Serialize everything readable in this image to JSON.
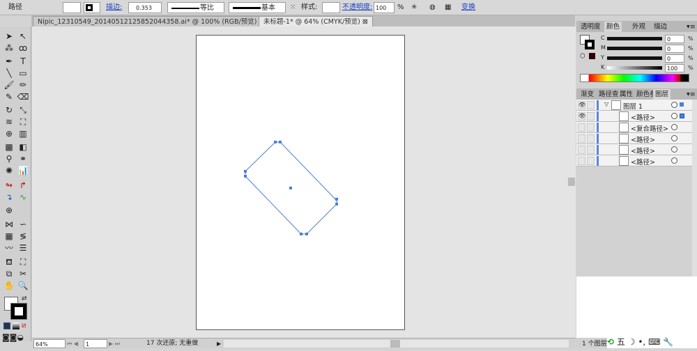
{
  "control_bar": {
    "selection_label": "路径",
    "stroke_label": "描边:",
    "stroke_weight": "0.353",
    "profile_label": "等比",
    "brush_label": "基本",
    "style_label": "样式:",
    "opacity_label": "不透明度:",
    "opacity_value": "100",
    "opacity_unit": "%",
    "transform_label": "变换"
  },
  "doc_tabs": [
    {
      "label": "Nipic_12310549_20140512125852044358.ai* @ 100% (RGB/预览)",
      "active": false
    },
    {
      "label": "未标题-1* @ 64% (CMYK/预览)",
      "active": true
    }
  ],
  "color_panel": {
    "tabs": [
      "透明度",
      "颜色",
      "外观",
      "描边"
    ],
    "active_tab": "颜色",
    "channels": [
      {
        "label": "C",
        "value": "0"
      },
      {
        "label": "M",
        "value": "0"
      },
      {
        "label": "Y",
        "value": "0"
      },
      {
        "label": "K",
        "value": "100"
      }
    ],
    "unit": "%"
  },
  "layers_panel": {
    "tabs": [
      "渐变",
      "路径查",
      "属性",
      "颜色参",
      "图层"
    ],
    "active_tab": "图层",
    "layer_name": "图层 1",
    "items": [
      "<路径>",
      "<复合路径>",
      "<路径>",
      "<路径>",
      "<路径>"
    ],
    "footer": "1 个图层"
  },
  "status_bar": {
    "zoom": "64%",
    "page": "1",
    "status_text": "17 次还原; 无重做"
  },
  "colors": {
    "selection": "#4a7fd6",
    "ime_green": "#1fa01f"
  }
}
